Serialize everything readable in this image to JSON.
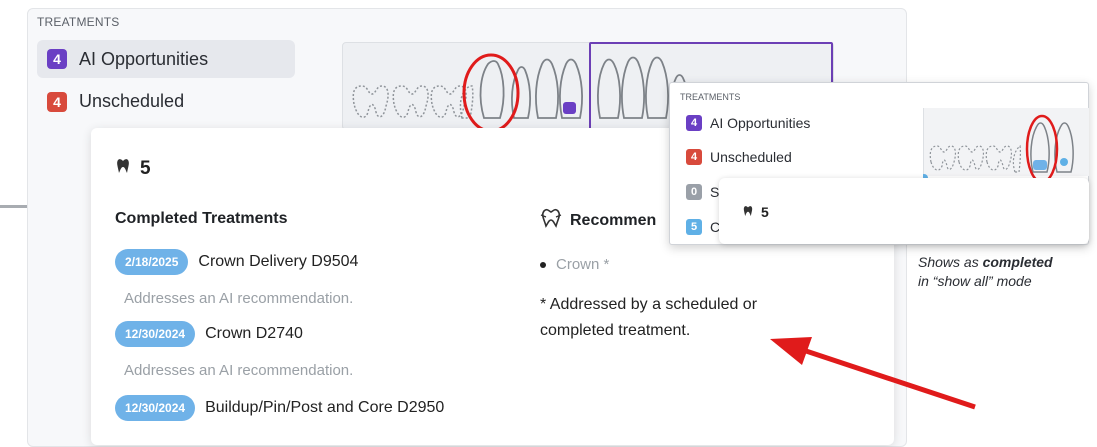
{
  "treatments_panel": {
    "section_label": "TREATMENTS",
    "categories": [
      {
        "count": "4",
        "label": "AI Opportunities",
        "color": "#6a3fc4"
      },
      {
        "count": "4",
        "label": "Unscheduled",
        "color": "#d84a3c"
      }
    ]
  },
  "tooth_card": {
    "tooth_number": "5",
    "completed_heading": "Completed Treatments",
    "treatments": [
      {
        "date": "2/18/2025",
        "name": "Crown Delivery D9504",
        "note": "Addresses an AI recommendation."
      },
      {
        "date": "12/30/2024",
        "name": "Crown D2740",
        "note": "Addresses an AI recommendation."
      },
      {
        "date": "12/30/2024",
        "name": "Buildup/Pin/Post and Core D2950",
        "note": ""
      }
    ],
    "recommend_heading": "Recommen",
    "recommendation": "Crown *",
    "footnote": "* Addressed by a scheduled or completed treatment."
  },
  "inset": {
    "section_label": "TREATMENTS",
    "categories": [
      {
        "count": "4",
        "label": "AI Opportunities",
        "color": "#6a3fc4"
      },
      {
        "count": "4",
        "label": "Unscheduled",
        "color": "#d84a3c"
      },
      {
        "count": "0",
        "label": "S",
        "color": "#9aa0a8"
      },
      {
        "count": "5",
        "label": "C",
        "color": "#5fb0e6"
      }
    ],
    "tooth_number": "5"
  },
  "caption": {
    "line1_prefix": "Shows as ",
    "line1_bold": "completed",
    "line2": "in “show all” mode"
  },
  "colors": {
    "accent_purple": "#6c3fb5",
    "highlight_red": "#e01b1b",
    "pill_blue": "#6fb2e8"
  }
}
